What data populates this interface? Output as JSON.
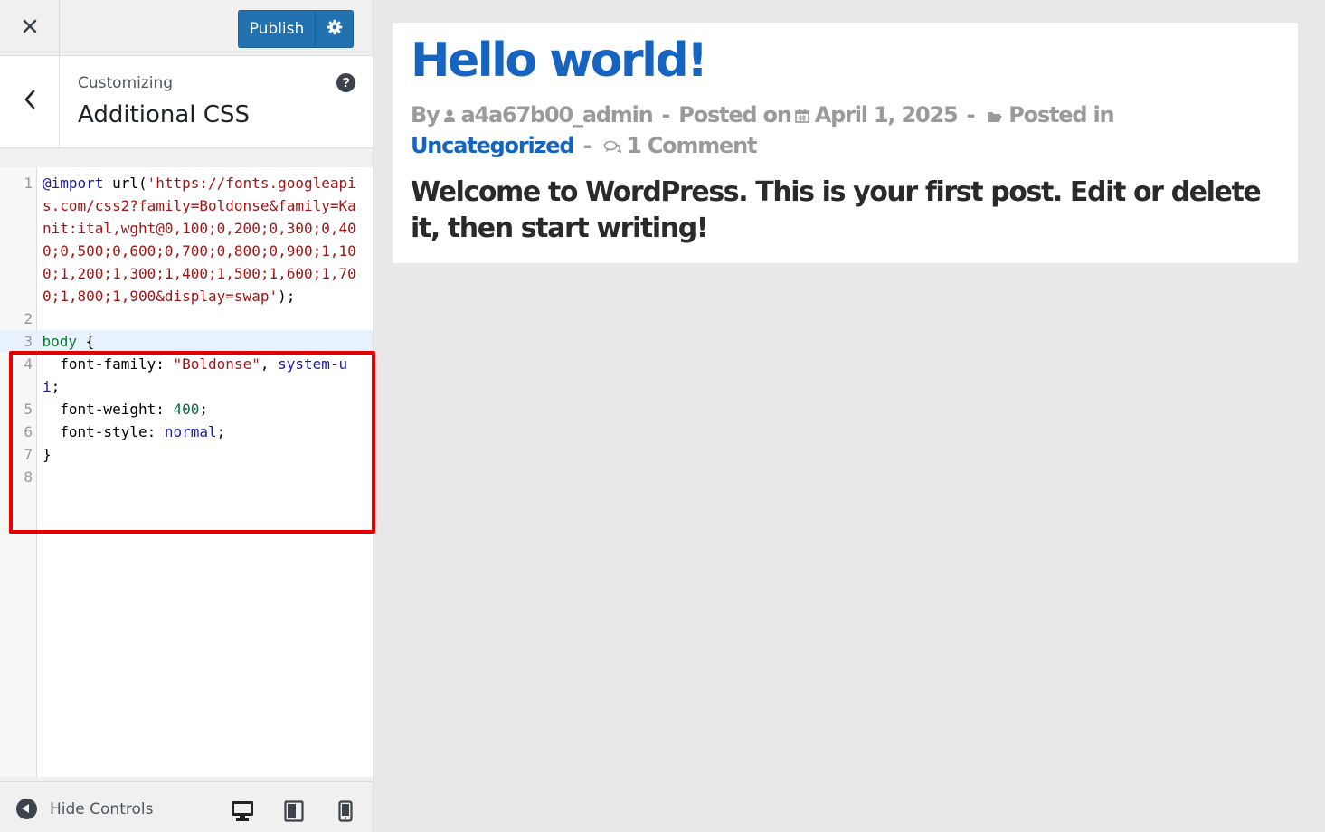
{
  "topbar": {
    "close_icon": "close-icon",
    "publish_label": "Publish",
    "publish_settings_icon": "gear-icon",
    "accent": "#2271b1"
  },
  "section": {
    "back_icon": "chevron-left-icon",
    "subtitle": "Customizing",
    "title": "Additional CSS",
    "help_label": "?"
  },
  "editor": {
    "line_numbers": [
      "1",
      "2",
      "3",
      "4",
      "5",
      "6",
      "7",
      "8"
    ],
    "lines": {
      "l1_kw": "@import",
      "l1_url_fn": "url(",
      "l1_url_str": "'https://fonts.googleapis.com/css2?family=Boldonse&family=Kanit:ital,wght@0,100;0,200;0,300;0,400;0,500;0,600;0,700;0,800;0,900;1,100;1,200;1,300;1,400;1,500;1,600;1,700;1,800;1,900&display=swap'",
      "l1_end": ");",
      "l3_sel": "body",
      "l3_brace": " {",
      "l4_prop": "  font-family: ",
      "l4_str": "\"Boldonse\"",
      "l4_sep": ", ",
      "l4_val": "system-ui",
      "l4_end": ";",
      "l5_prop": "  font-weight: ",
      "l5_num": "400",
      "l5_end": ";",
      "l6_prop": "  font-style: ",
      "l6_val": "normal",
      "l6_end": ";",
      "l7_brace": "}"
    },
    "highlight_color": "#e60000"
  },
  "footer": {
    "hide_controls_label": "Hide Controls",
    "devices": [
      "desktop-icon",
      "tablet-icon",
      "mobile-icon"
    ]
  },
  "preview": {
    "post_title": "Hello world!",
    "meta": {
      "by": "By",
      "author": "a4a67b00_admin",
      "sep": "-",
      "posted_on": "Posted on",
      "date": "April 1, 2025",
      "posted_in": "Posted in",
      "category": "Uncategorized",
      "comments": "1 Comment"
    },
    "content": "Welcome to WordPress. This is your first post. Edit or delete it, then start writing!",
    "link_color": "#1664c0"
  }
}
